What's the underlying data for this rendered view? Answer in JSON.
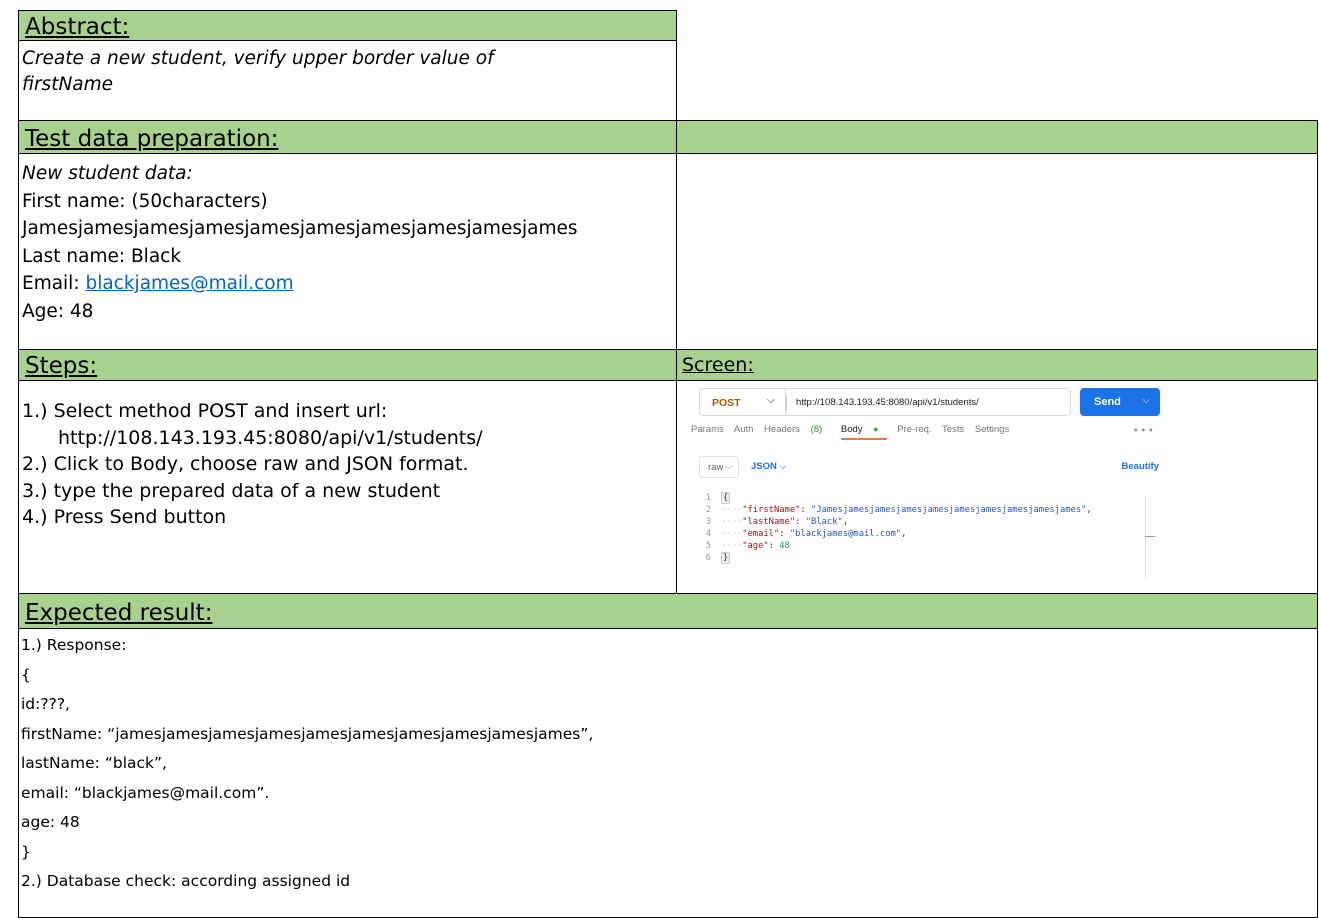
{
  "headers": {
    "abstract": "Abstract:",
    "test_data": "Test data preparation:",
    "steps": "Steps:",
    "screen": "Screen:",
    "expected": "Expected result:"
  },
  "abstract": {
    "line1": "Create a new student, verify upper border value of",
    "line2": "firstName"
  },
  "test_data": {
    "intro": "New student data:",
    "first_name_label": "First name: (50characters)",
    "first_name_value": "Jamesjamesjamesjamesjamesjamesjamesjamesjamesjames",
    "last_name": "Last name: Black",
    "email_label": "Email: ",
    "email_link": "blackjames@mail.com",
    "age": "Age: 48"
  },
  "steps": [
    "1.) Select method POST and insert url:",
    "http://108.143.193.45:8080/api/v1/students/",
    "2.) Click to Body, choose raw and JSON format.",
    "3.) type the prepared data of a new student",
    "4.) Press Send button"
  ],
  "screen": {
    "method": "POST",
    "url": "http://108.143.193.45:8080/api/v1/students/",
    "send": "Send",
    "tabs": {
      "params": "Params",
      "auth": "Auth",
      "headers": "Headers",
      "headers_count": "(8)",
      "body": "Body",
      "prereq": "Pre-req.",
      "tests": "Tests",
      "settings": "Settings"
    },
    "more": "•••",
    "raw": "raw",
    "json": "JSON",
    "beautify": "Beautify",
    "code": {
      "ln": [
        "1",
        "2",
        "3",
        "4",
        "5",
        "6"
      ],
      "open": "{",
      "close": "}",
      "k_first": "\"firstName\"",
      "v_first": "\"Jamesjamesjamesjamesjamesjamesjamesjamesjamesjames\"",
      "k_last": "\"lastName\"",
      "v_last": "\"Black\"",
      "k_email": "\"email\"",
      "v_email": "\"blackjames@mail.com\"",
      "k_age": "\"age\"",
      "v_age": "48"
    }
  },
  "expected": [
    "1.) Response:",
    "{",
    "id:???,",
    "firstName: “jamesjamesjamesjamesjamesjamesjamesjamesjamesjames”,",
    "lastName: “black”,",
    "email: “blackjames@mail.com”.",
    "age: 48",
    "}",
    "2.) Database check: according assigned id"
  ],
  "colors": {
    "header_green": "#a9d18e",
    "link_blue": "#0563c1",
    "send_blue": "#1a73e8",
    "post_orange": "#b05a00"
  }
}
